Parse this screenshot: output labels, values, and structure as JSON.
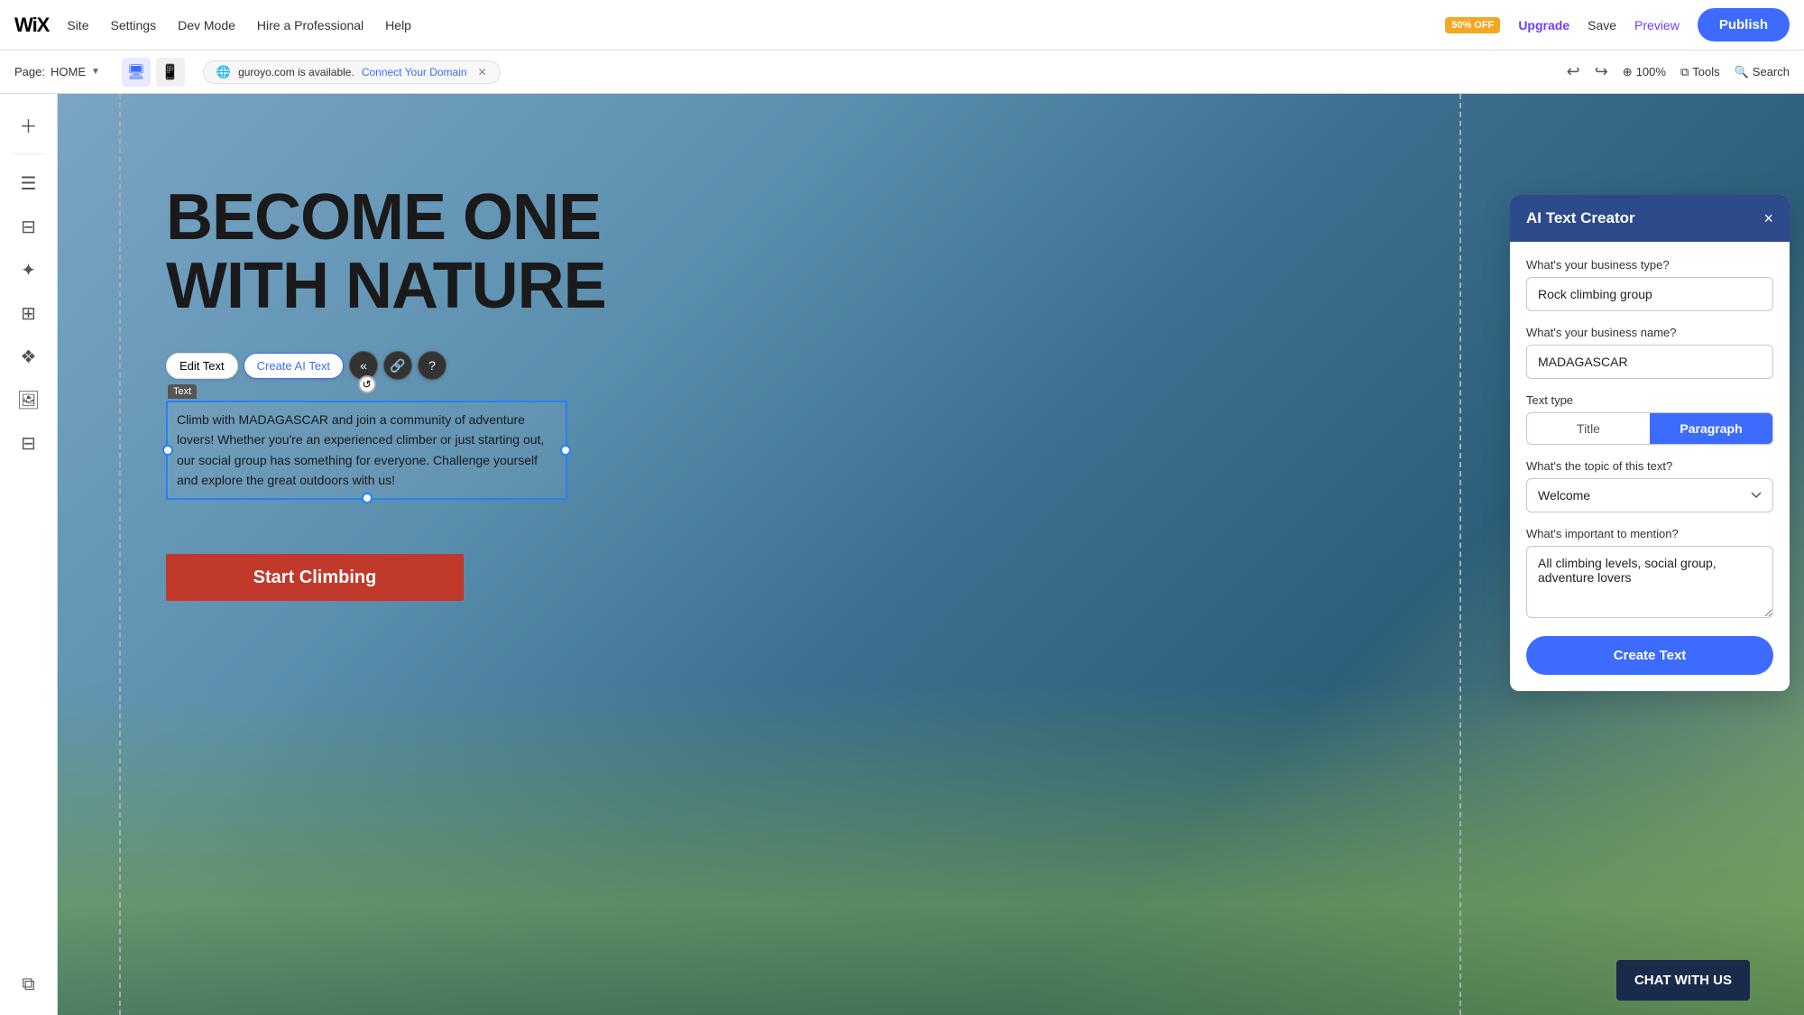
{
  "topbar": {
    "logo": "WiX",
    "nav": {
      "site": "Site",
      "settings": "Settings",
      "dev_mode": "Dev Mode",
      "hire": "Hire a Professional",
      "help": "Help"
    },
    "badge": "50% OFF",
    "upgrade": "Upgrade",
    "save": "Save",
    "preview": "Preview",
    "publish": "Publish"
  },
  "toolbar2": {
    "page_label": "Page:",
    "page_name": "HOME",
    "domain_text": "guroyo.com is available.",
    "connect_domain": "Connect Your Domain",
    "zoom": "100%",
    "tools": "Tools",
    "search": "Search"
  },
  "ai_dialog": {
    "title": "AI Text Creator",
    "close_label": "×",
    "business_type_label": "What's your business type?",
    "business_type_value": "Rock climbing group",
    "business_name_label": "What's your business name?",
    "business_name_value": "MADAGASCAR",
    "text_type_label": "Text type",
    "type_title": "Title",
    "type_paragraph": "Paragraph",
    "topic_label": "What's the topic of this text?",
    "topic_value": "Welcome",
    "mention_label": "What's important to mention?",
    "mention_value": "All climbing levels, social group, adventure lovers",
    "create_button": "Create Text"
  },
  "hero": {
    "title_line1": "BECOME ONE",
    "title_line2": "WITH NATURE",
    "paragraph": "Climb with MADAGASCAR and join a community of adventure lovers! Whether you're an experienced climber or just starting out, our social group has something for everyone. Challenge yourself and explore the great outdoors with us!",
    "text_label": "Text",
    "cta_button": "Start Climbing"
  },
  "text_toolbar": {
    "edit_text": "Edit Text",
    "create_ai": "Create AI Text",
    "history_icon": "«",
    "link_icon": "🔗",
    "help_icon": "?"
  },
  "chat_widget": {
    "label": "CHAT WITH US"
  }
}
